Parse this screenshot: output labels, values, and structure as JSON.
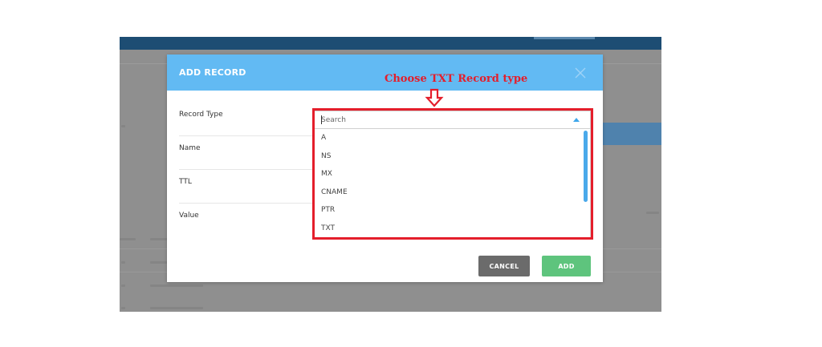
{
  "modal": {
    "title": "ADD RECORD",
    "fields": {
      "record_type": "Record Type",
      "name": "Name",
      "ttl": "TTL",
      "value": "Value"
    },
    "search_placeholder": "Search",
    "options": [
      "A",
      "NS",
      "MX",
      "CNAME",
      "PTR",
      "TXT"
    ],
    "buttons": {
      "cancel": "CANCEL",
      "add": "ADD"
    }
  },
  "annotation": {
    "text": "Choose TXT Record type",
    "color": "#e41e2b"
  },
  "colors": {
    "modal_header": "#62baf3",
    "cancel_button": "#6b6b6b",
    "add_button": "#5ec47d",
    "accent": "#3ea7ec"
  },
  "icons": {
    "close": "close-icon",
    "dropdown": "chevron-up-icon",
    "annotation_arrow": "down-arrow-icon"
  }
}
